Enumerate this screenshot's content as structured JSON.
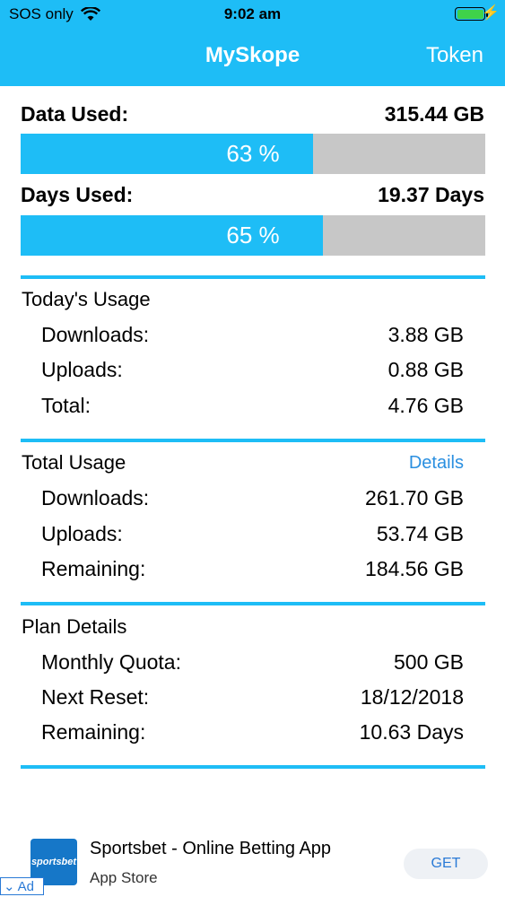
{
  "status_bar": {
    "carrier": "SOS only",
    "time": "9:02 am",
    "icons": [
      "wifi-icon",
      "battery-icon",
      "charging-bolt-icon"
    ]
  },
  "nav": {
    "title": "MySkope",
    "token_label": "Token"
  },
  "usage_summary": {
    "data_used": {
      "label": "Data Used:",
      "value": "315.44 GB",
      "percent_text": "63 %",
      "percent": 63
    },
    "days_used": {
      "label": "Days Used:",
      "value": "19.37 Days",
      "percent_text": "65 %",
      "percent": 65
    }
  },
  "todays_usage": {
    "title": "Today's Usage",
    "rows": [
      {
        "label": "Downloads:",
        "value": "3.88 GB"
      },
      {
        "label": "Uploads:",
        "value": "0.88 GB"
      },
      {
        "label": "Total:",
        "value": "4.76 GB"
      }
    ]
  },
  "total_usage": {
    "title": "Total Usage",
    "details_link": "Details",
    "rows": [
      {
        "label": "Downloads:",
        "value": "261.70 GB"
      },
      {
        "label": "Uploads:",
        "value": "53.74 GB"
      },
      {
        "label": "Remaining:",
        "value": "184.56 GB"
      }
    ]
  },
  "plan_details": {
    "title": "Plan Details",
    "rows": [
      {
        "label": "Monthly Quota:",
        "value": "500 GB"
      },
      {
        "label": "Next Reset:",
        "value": "18/12/2018"
      },
      {
        "label": "Remaining:",
        "value": "10.63 Days"
      }
    ]
  },
  "ad": {
    "logo_text": "sportsbet",
    "title": "Sportsbet - Online Betting App",
    "subtitle": "App Store",
    "button_label": "GET",
    "badge_label": "Ad"
  },
  "colors": {
    "accent": "#1ebdf6",
    "bar_background": "#c7c7c7",
    "link": "#2a8fe0"
  }
}
